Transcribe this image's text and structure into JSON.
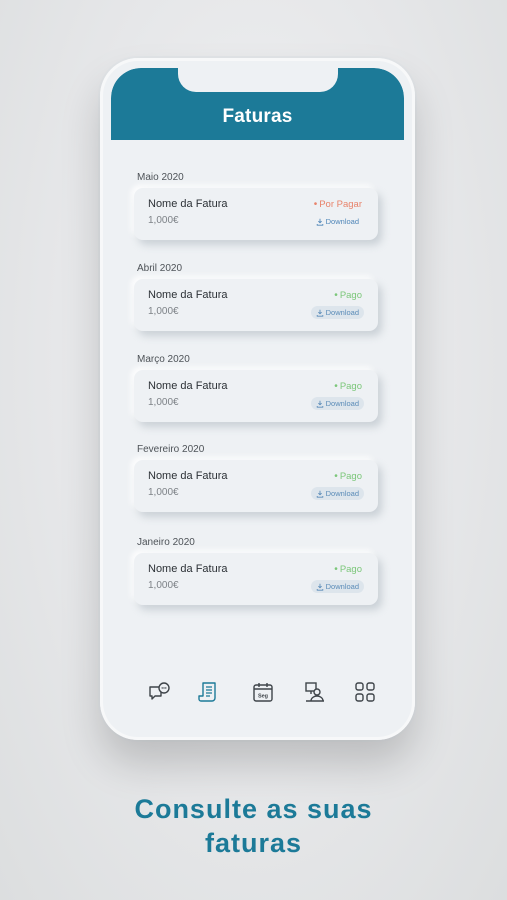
{
  "header": {
    "title": "Faturas"
  },
  "invoices": [
    {
      "month": "Maio 2020",
      "name": "Nome da Fatura",
      "amount": "1,000€",
      "status": "Por Pagar",
      "status_color": "#e8836b",
      "download": "Download"
    },
    {
      "month": "Abril 2020",
      "name": "Nome da Fatura",
      "amount": "1,000€",
      "status": "Pago",
      "status_color": "#7cc77a",
      "download": "Download"
    },
    {
      "month": "Março 2020",
      "name": "Nome da Fatura",
      "amount": "1,000€",
      "status": "Pago",
      "status_color": "#7cc77a",
      "download": "Download"
    },
    {
      "month": "Fevereiro 2020",
      "name": "Nome da Fatura",
      "amount": "1,000€",
      "status": "Pago",
      "status_color": "#7cc77a",
      "download": "Download"
    },
    {
      "month": "Janeiro 2020",
      "name": "Nome da Fatura",
      "amount": "1,000€",
      "status": "Pago",
      "status_color": "#7cc77a",
      "download": "Download"
    }
  ],
  "tabbar": {
    "items": [
      {
        "icon": "chat-bubble-icon",
        "active": false
      },
      {
        "icon": "invoice-document-icon",
        "active": true
      },
      {
        "icon": "calendar-icon",
        "active": false,
        "label": "Seg"
      },
      {
        "icon": "person-desk-icon",
        "active": false
      },
      {
        "icon": "grid-menu-icon",
        "active": false
      }
    ]
  },
  "caption": {
    "line1": "Consulte as suas",
    "line2": "faturas"
  },
  "colors": {
    "brand": "#1c7a98",
    "background": "#eef1f4"
  }
}
